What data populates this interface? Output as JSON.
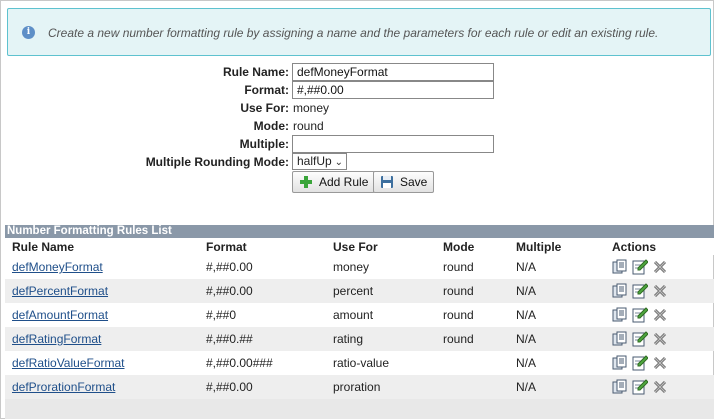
{
  "info": {
    "message": "Create a new number formatting rule by assigning a name and the parameters for each rule or edit an existing rule."
  },
  "form": {
    "rule_name_label": "Rule Name:",
    "rule_name_value": "defMoneyFormat",
    "format_label": "Format:",
    "format_value": "#,##0.00",
    "use_for_label": "Use For:",
    "use_for_value": "money",
    "mode_label": "Mode:",
    "mode_value": "round",
    "multiple_label": "Multiple:",
    "multiple_value": "",
    "rounding_label": "Multiple Rounding Mode:",
    "rounding_value": "halfUp",
    "add_rule_label": "Add Rule",
    "save_label": "Save"
  },
  "list": {
    "title": "Number Formatting Rules List",
    "columns": [
      "Rule Name",
      "Format",
      "Use For",
      "Mode",
      "Multiple",
      "Actions"
    ],
    "rows": [
      {
        "name": "defMoneyFormat",
        "format": "#,##0.00",
        "use_for": "money",
        "mode": "round",
        "multiple": "N/A"
      },
      {
        "name": "defPercentFormat",
        "format": "#,##0.00",
        "use_for": "percent",
        "mode": "round",
        "multiple": "N/A"
      },
      {
        "name": "defAmountFormat",
        "format": "#,##0",
        "use_for": "amount",
        "mode": "round",
        "multiple": "N/A"
      },
      {
        "name": "defRatingFormat",
        "format": "#,##0.##",
        "use_for": "rating",
        "mode": "round",
        "multiple": "N/A"
      },
      {
        "name": "defRatioValueFormat",
        "format": "#,##0.00###",
        "use_for": "ratio-value",
        "mode": "",
        "multiple": "N/A"
      },
      {
        "name": "defProrationFormat",
        "format": "#,##0.00",
        "use_for": "proration",
        "mode": "",
        "multiple": "N/A"
      }
    ]
  },
  "icons": {
    "info": "info-icon",
    "add": "plus-icon",
    "save": "floppy-disk-icon",
    "copy": "copy-icon",
    "edit": "edit-icon",
    "delete": "delete-icon"
  },
  "colors": {
    "info_bg": "#e4f4f6",
    "info_border": "#5ec2cf",
    "list_title_bg": "#8a98a8",
    "link": "#1f4f8a",
    "add_green": "#3aa53a"
  }
}
